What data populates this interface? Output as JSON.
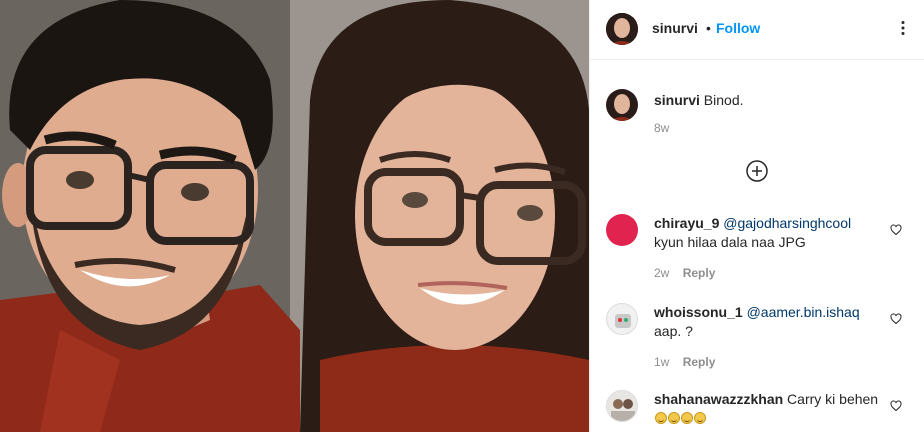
{
  "post": {
    "author": "sinurvi",
    "separator": "•",
    "follow_label": "Follow",
    "caption_user": "sinurvi",
    "caption_text": "Binod.",
    "caption_age": "8w"
  },
  "comments": [
    {
      "user": "chirayu_9",
      "mention": "@gajodharsinghcool",
      "text": "kyun hilaa dala naa JPG",
      "age": "2w",
      "reply_label": "Reply"
    },
    {
      "user": "whoissonu_1",
      "mention": "@aamer.bin.ishaq",
      "text": "aap. ?",
      "age": "1w",
      "reply_label": "Reply"
    },
    {
      "user": "shahanawazzzkhan",
      "text": "Carry ki behen",
      "emoji_count": 4
    }
  ],
  "colors": {
    "follow": "#0095f6",
    "mention": "#00376b",
    "meta": "#8e8e8e",
    "chirayu_avatar": "#e0244f"
  },
  "icons": [
    "more-options-icon",
    "load-more-comments-icon",
    "heart-icon"
  ]
}
